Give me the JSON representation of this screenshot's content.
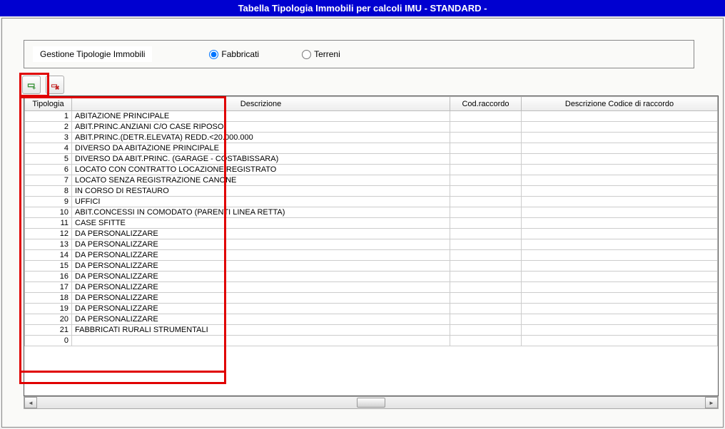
{
  "title": "Tabella Tipologia Immobili per calcoli IMU - STANDARD -",
  "filter": {
    "label": "Gestione Tipologie Immobili",
    "options": {
      "fabbricati": "Fabbricati",
      "terreni": "Terreni"
    },
    "selected": "fabbricati"
  },
  "grid": {
    "headers": {
      "tipologia": "Tipologia",
      "descrizione": "Descrizione",
      "codraccordo": "Cod.raccordo",
      "descrcod": "Descrizione Codice di raccordo"
    },
    "rows": [
      {
        "tipologia": "1",
        "descrizione": "ABITAZIONE PRINCIPALE",
        "codraccordo": "",
        "descrcod": ""
      },
      {
        "tipologia": "2",
        "descrizione": "ABIT.PRINC.ANZIANI C/O CASE RIPOSO",
        "codraccordo": "",
        "descrcod": ""
      },
      {
        "tipologia": "3",
        "descrizione": "ABIT.PRINC.(DETR.ELEVATA) REDD.<20.000.000",
        "codraccordo": "",
        "descrcod": ""
      },
      {
        "tipologia": "4",
        "descrizione": "DIVERSO DA ABITAZIONE PRINCIPALE",
        "codraccordo": "",
        "descrcod": ""
      },
      {
        "tipologia": "5",
        "descrizione": "DIVERSO DA ABIT.PRINC. (GARAGE - COSTABISSARA)",
        "codraccordo": "",
        "descrcod": ""
      },
      {
        "tipologia": "6",
        "descrizione": "LOCATO CON CONTRATTO LOCAZIONE REGISTRATO",
        "codraccordo": "",
        "descrcod": ""
      },
      {
        "tipologia": "7",
        "descrizione": "LOCATO SENZA REGISTRAZIONE CANONE",
        "codraccordo": "",
        "descrcod": ""
      },
      {
        "tipologia": "8",
        "descrizione": "IN CORSO DI RESTAURO",
        "codraccordo": "",
        "descrcod": ""
      },
      {
        "tipologia": "9",
        "descrizione": "UFFICI",
        "codraccordo": "",
        "descrcod": ""
      },
      {
        "tipologia": "10",
        "descrizione": "ABIT.CONCESSI IN COMODATO (PARENTI LINEA RETTA)",
        "codraccordo": "",
        "descrcod": ""
      },
      {
        "tipologia": "11",
        "descrizione": "CASE SFITTE",
        "codraccordo": "",
        "descrcod": ""
      },
      {
        "tipologia": "12",
        "descrizione": "DA PERSONALIZZARE",
        "codraccordo": "",
        "descrcod": ""
      },
      {
        "tipologia": "13",
        "descrizione": "DA PERSONALIZZARE",
        "codraccordo": "",
        "descrcod": ""
      },
      {
        "tipologia": "14",
        "descrizione": "DA PERSONALIZZARE",
        "codraccordo": "",
        "descrcod": ""
      },
      {
        "tipologia": "15",
        "descrizione": "DA PERSONALIZZARE",
        "codraccordo": "",
        "descrcod": ""
      },
      {
        "tipologia": "16",
        "descrizione": "DA PERSONALIZZARE",
        "codraccordo": "",
        "descrcod": ""
      },
      {
        "tipologia": "17",
        "descrizione": "DA PERSONALIZZARE",
        "codraccordo": "",
        "descrcod": ""
      },
      {
        "tipologia": "18",
        "descrizione": "DA PERSONALIZZARE",
        "codraccordo": "",
        "descrcod": ""
      },
      {
        "tipologia": "19",
        "descrizione": "DA PERSONALIZZARE",
        "codraccordo": "",
        "descrcod": ""
      },
      {
        "tipologia": "20",
        "descrizione": "DA PERSONALIZZARE",
        "codraccordo": "",
        "descrcod": ""
      },
      {
        "tipologia": "21",
        "descrizione": "FABBRICATI RURALI STRUMENTALI",
        "codraccordo": "",
        "descrcod": ""
      },
      {
        "tipologia": "0",
        "descrizione": "",
        "codraccordo": "",
        "descrcod": ""
      }
    ]
  }
}
